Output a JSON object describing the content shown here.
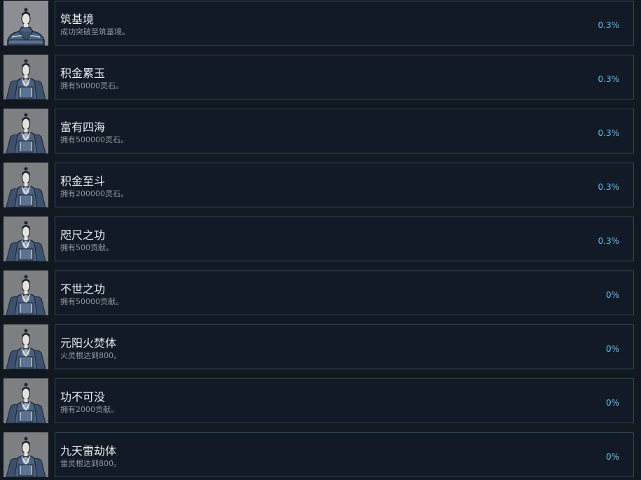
{
  "achievements": [
    {
      "title": "筑基境",
      "description": "成功突破至筑基境。",
      "percent": "0.3%",
      "icon": "cultivator-meditating-icon"
    },
    {
      "title": "积金累玉",
      "description": "拥有50000灵石。",
      "percent": "0.3%",
      "icon": "cultivator-robed-icon"
    },
    {
      "title": "富有四海",
      "description": "拥有500000灵石。",
      "percent": "0.3%",
      "icon": "cultivator-robed-icon"
    },
    {
      "title": "积金至斗",
      "description": "拥有200000灵石。",
      "percent": "0.3%",
      "icon": "cultivator-robed-icon"
    },
    {
      "title": "咫尺之功",
      "description": "拥有500贡献。",
      "percent": "0.3%",
      "icon": "cultivator-robed-icon"
    },
    {
      "title": "不世之功",
      "description": "拥有50000贡献。",
      "percent": "0%",
      "icon": "cultivator-robed-icon"
    },
    {
      "title": "元阳火焚体",
      "description": "火灵根达到800。",
      "percent": "0%",
      "icon": "cultivator-robed-icon"
    },
    {
      "title": "功不可没",
      "description": "拥有2000贡献。",
      "percent": "0%",
      "icon": "cultivator-robed-icon"
    },
    {
      "title": "九天雷劫体",
      "description": "雷灵根达到800。",
      "percent": "0%",
      "icon": "cultivator-robed-icon"
    }
  ],
  "colors": {
    "background": "#111820",
    "card_border": "#2c4a5c",
    "title": "#e8ecef",
    "description": "#8f98a0",
    "percent": "#66c0f4"
  }
}
